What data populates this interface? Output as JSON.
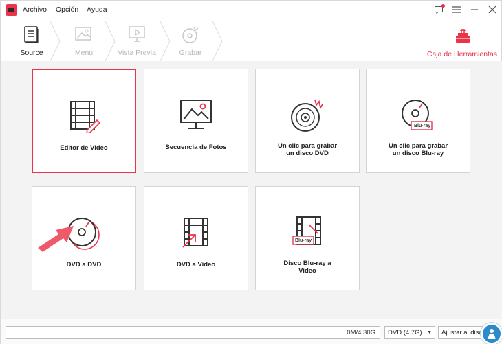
{
  "menu": {
    "items": [
      "Archivo",
      "Opción",
      "Ayuda"
    ]
  },
  "window_controls": [
    "feedback-icon",
    "menu-icon",
    "minimize-icon",
    "close-icon"
  ],
  "steps": [
    {
      "label": "Source",
      "state": "active",
      "icon": "document-icon"
    },
    {
      "label": "Menú",
      "state": "disabled",
      "icon": "image-icon"
    },
    {
      "label": "Vista Previa",
      "state": "disabled",
      "icon": "monitor-play-icon"
    },
    {
      "label": "Grabar",
      "state": "disabled",
      "icon": "disc-icon"
    }
  ],
  "toolbox": {
    "label": "Caja de Herramientas",
    "icon": "toolbox-icon"
  },
  "tiles": [
    {
      "label": "Editor de Video",
      "icon": "video-editor-icon",
      "selected": true
    },
    {
      "label": "Secuencia de Fotos",
      "icon": "photo-slideshow-icon"
    },
    {
      "label_line1": "Un clic para grabar",
      "label_line2": "un disco DVD",
      "icon": "burn-dvd-icon"
    },
    {
      "label_line1": "Un clic para grabar",
      "label_line2": "un disco Blu-ray",
      "icon": "burn-bluray-icon",
      "badge": "Blu-ray"
    },
    {
      "label": "DVD a DVD",
      "icon": "dvd-copy-icon"
    },
    {
      "label": "DVD a Video",
      "icon": "dvd-to-video-icon"
    },
    {
      "label_line1": "Disco Blu-ray a",
      "label_line2": "Video",
      "icon": "bluray-to-video-icon",
      "badge": "Blu-ray"
    }
  ],
  "status": {
    "progress_text": "0M/4.30G",
    "progress_fraction": 0,
    "disc_type": "DVD (4.7G)",
    "fit_mode": "Ajustar al disco"
  },
  "colors": {
    "accent": "#e8354a",
    "watermark": "#2e8ac9"
  }
}
